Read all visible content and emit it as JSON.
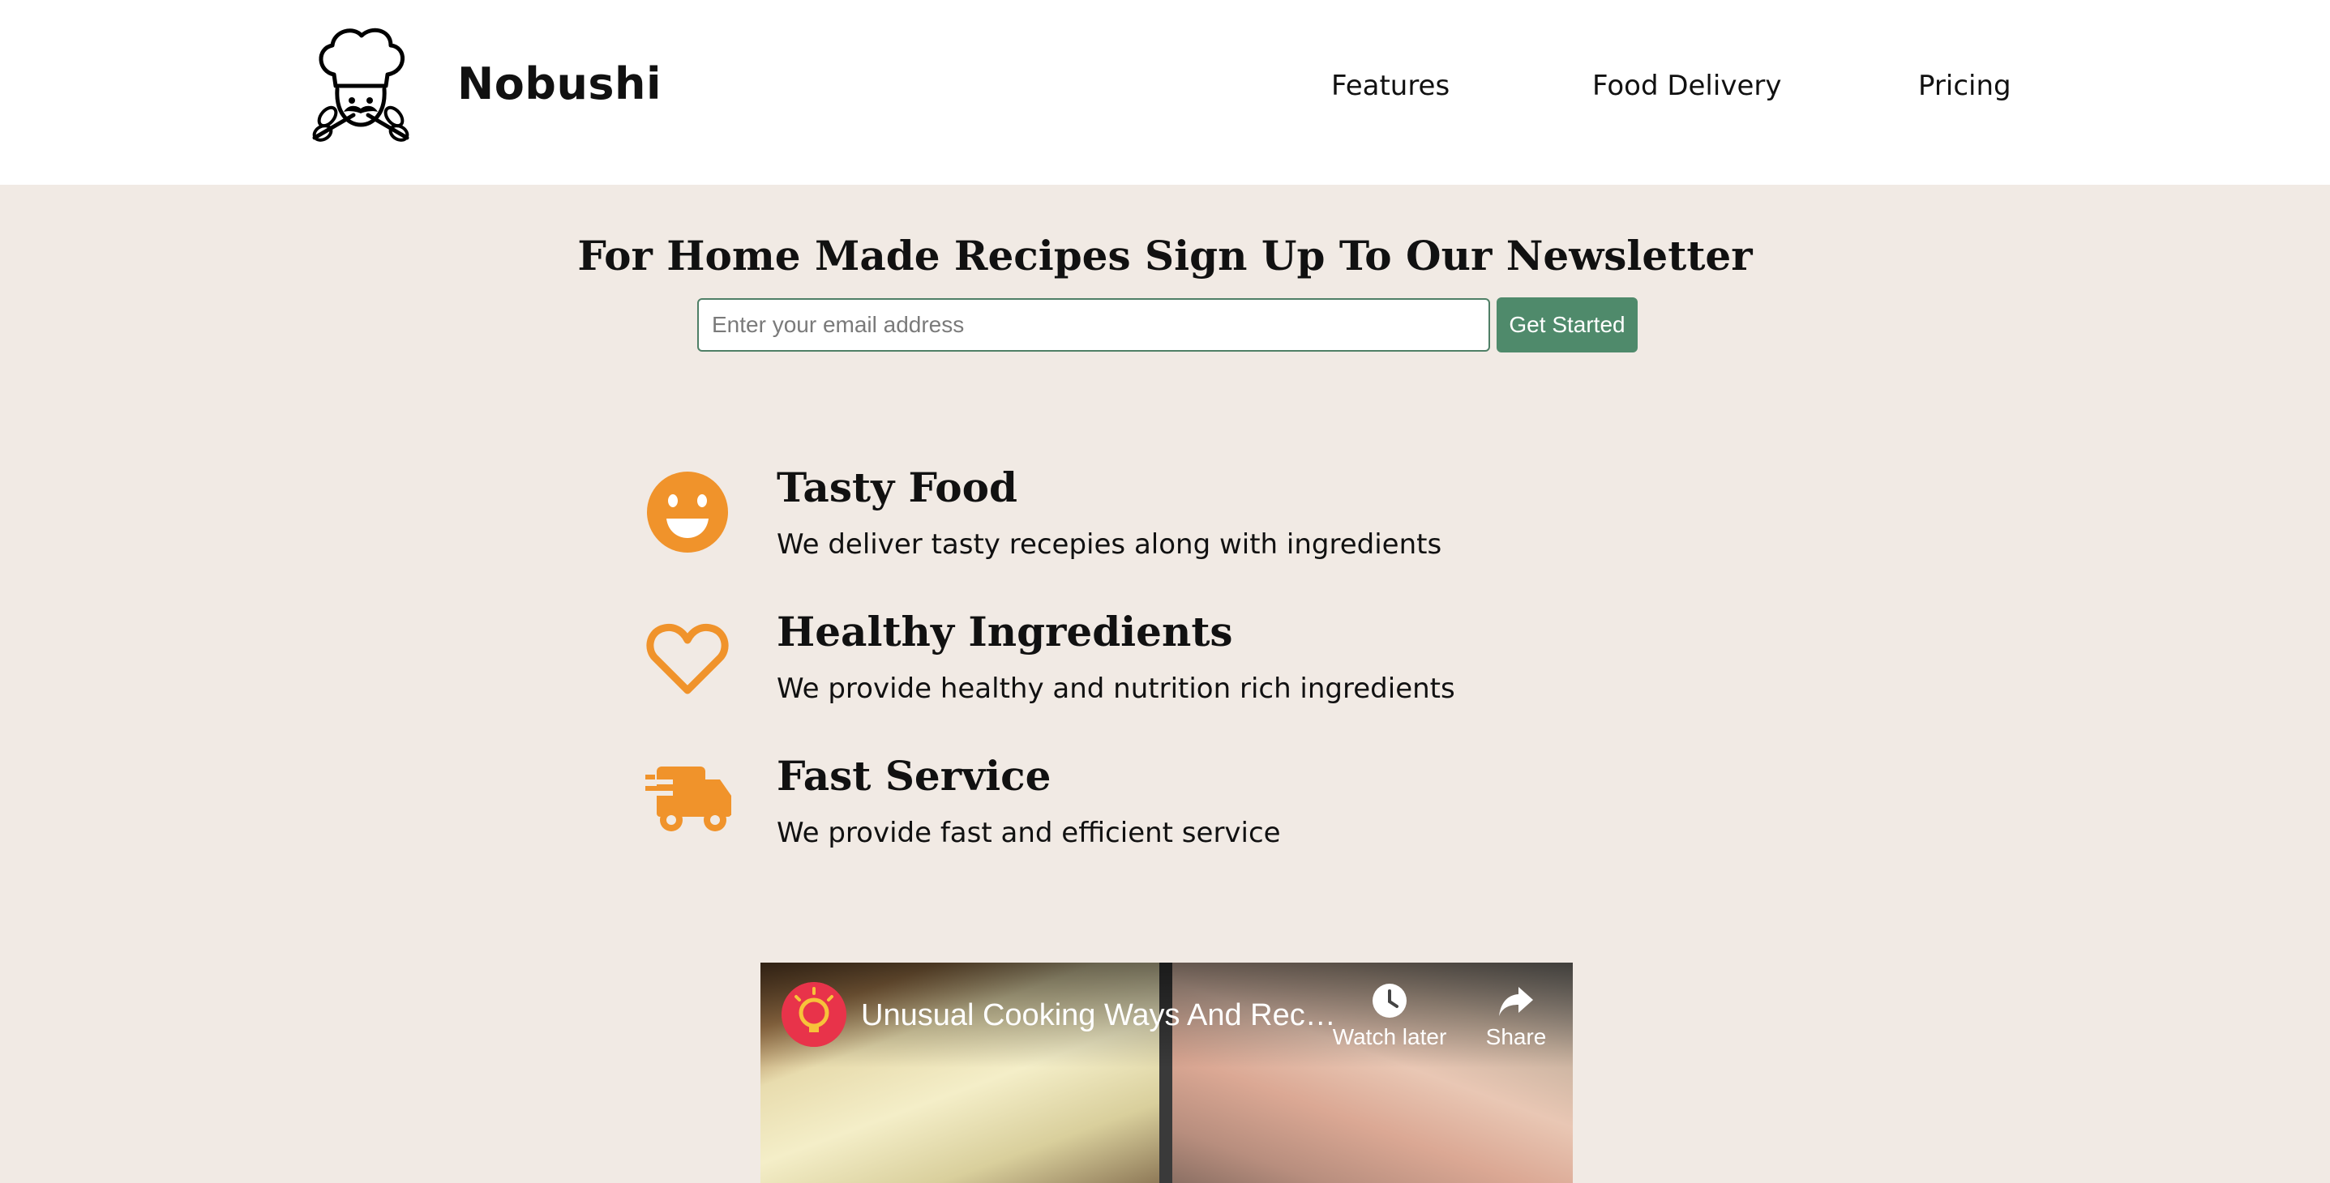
{
  "header": {
    "brand": "Nobushi",
    "nav": [
      "Features",
      "Food Delivery",
      "Pricing"
    ]
  },
  "newsletter": {
    "title": "For Home Made Recipes Sign Up To Our Newsletter",
    "placeholder": "Enter your email address",
    "button": "Get Started"
  },
  "features": [
    {
      "icon": "smiley-icon",
      "title": "Tasty Food",
      "desc": "We deliver tasty recepies along with ingredients"
    },
    {
      "icon": "heart-icon",
      "title": "Healthy Ingredients",
      "desc": "We provide healthy and nutrition rich ingredients"
    },
    {
      "icon": "delivery-truck-icon",
      "title": "Fast Service",
      "desc": "We provide fast and efficient service"
    }
  ],
  "video": {
    "title": "Unusual Cooking Ways And Rec…",
    "watch_later": "Watch later",
    "share": "Share"
  },
  "colors": {
    "accent": "#f0932b",
    "button": "#4f8a6b",
    "background": "#f1eae4"
  }
}
